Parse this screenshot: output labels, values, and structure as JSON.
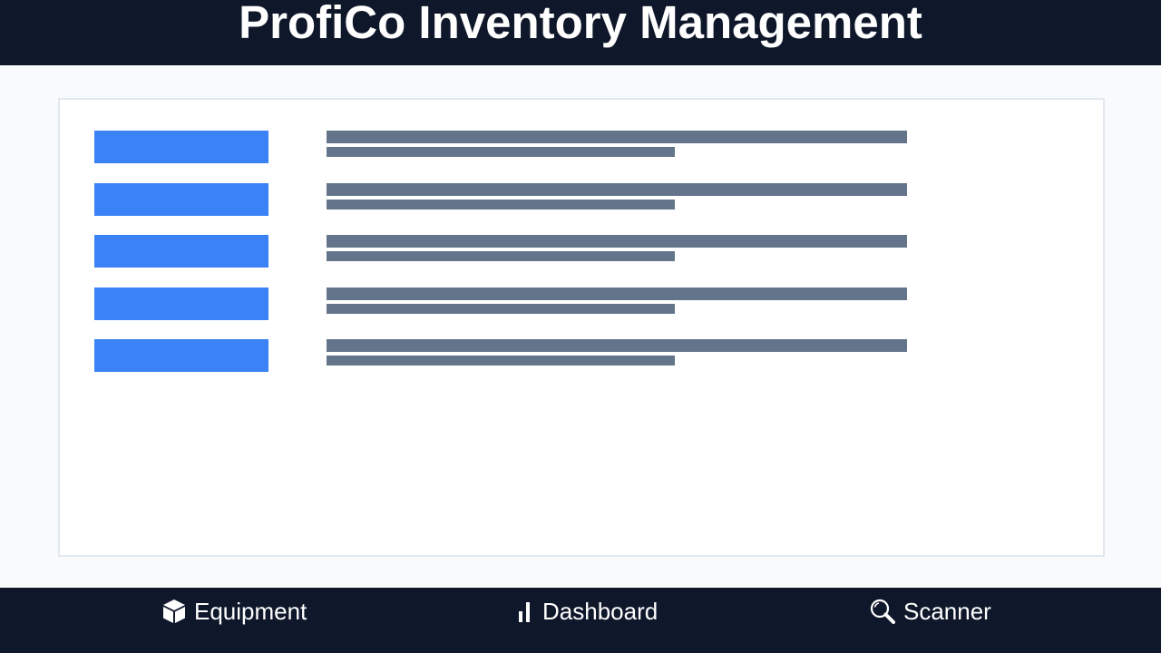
{
  "app": {
    "title": "ProfiCo Inventory Management"
  },
  "colors": {
    "header_bg": "#0f172a",
    "page_bg": "#f8fafc",
    "panel_border": "#e2e8f0",
    "accent_button": "#3b82f6",
    "placeholder_text": "#64748b"
  },
  "list": {
    "rows": [
      {
        "id": 1
      },
      {
        "id": 2
      },
      {
        "id": 3
      },
      {
        "id": 4
      },
      {
        "id": 5
      }
    ]
  },
  "nav": {
    "items": [
      {
        "label": "Equipment",
        "icon": "box-icon"
      },
      {
        "label": "Dashboard",
        "icon": "bar-chart-icon"
      },
      {
        "label": "Scanner",
        "icon": "magnifier-icon"
      }
    ]
  }
}
